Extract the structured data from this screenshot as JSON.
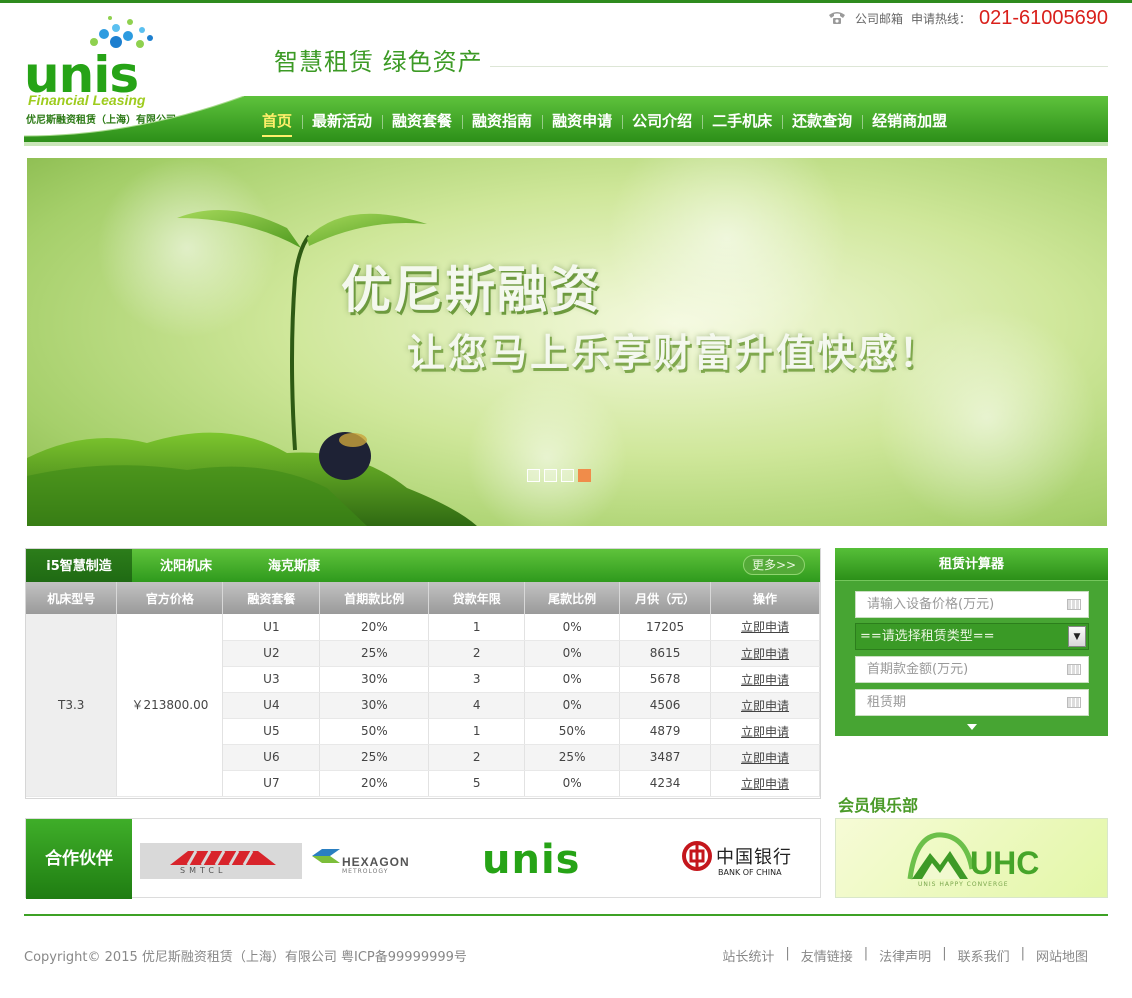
{
  "brand": {
    "logo_word": "unis",
    "logo_sub": "Financial  Leasing",
    "logo_cn": "优尼斯融资租赁（上海）有限公司",
    "slogan": "智慧租赁 绿色资产",
    "accent": "#3da125"
  },
  "topbar": {
    "mail": "公司邮箱",
    "hotline_label": "申请热线：",
    "hotline": "021-61005690"
  },
  "nav": {
    "items": [
      "首页",
      "最新活动",
      "融资套餐",
      "融资指南",
      "融资申请",
      "公司介绍",
      "二手机床",
      "还款查询",
      "经销商加盟"
    ],
    "active": "首页"
  },
  "banner": {
    "title": "优尼斯融资",
    "subtitle": "让您马上乐享财富升值快感！",
    "slides": 4,
    "active_slide": 4
  },
  "products": {
    "tabs": [
      "i5智慧制造",
      "沈阳机床",
      "海克斯康"
    ],
    "more": "更多>>",
    "columns": [
      "机床型号",
      "官方价格",
      "融资套餐",
      "首期款比例",
      "贷款年限",
      "尾款比例",
      "月供（元）",
      "操作"
    ],
    "model": "T3.3",
    "price": "￥213800.00",
    "rows": [
      {
        "plan": "U1",
        "down": "20%",
        "years": "1",
        "final": "0%",
        "monthly": "17205",
        "action": "立即申请"
      },
      {
        "plan": "U2",
        "down": "25%",
        "years": "2",
        "final": "0%",
        "monthly": "8615",
        "action": "立即申请"
      },
      {
        "plan": "U3",
        "down": "30%",
        "years": "3",
        "final": "0%",
        "monthly": "5678",
        "action": "立即申请"
      },
      {
        "plan": "U4",
        "down": "30%",
        "years": "4",
        "final": "0%",
        "monthly": "4506",
        "action": "立即申请"
      },
      {
        "plan": "U5",
        "down": "50%",
        "years": "1",
        "final": "50%",
        "monthly": "4879",
        "action": "立即申请"
      },
      {
        "plan": "U6",
        "down": "25%",
        "years": "2",
        "final": "25%",
        "monthly": "3487",
        "action": "立即申请"
      },
      {
        "plan": "U7",
        "down": "20%",
        "years": "5",
        "final": "0%",
        "monthly": "4234",
        "action": "立即申请"
      }
    ]
  },
  "calculator": {
    "title": "租赁计算器",
    "price_placeholder": "请输入设备价格(万元)",
    "type_select": "==请选择租赁类型==",
    "down_placeholder": "首期款金额(万元)",
    "term_placeholder": "租赁期"
  },
  "club": {
    "title": "会员俱乐部",
    "logo": "UHC",
    "logo_sub": "UNIS HAPPY CONVERGE"
  },
  "partners": {
    "label": "合作伙伴",
    "logos": [
      {
        "name": "SMTCL"
      },
      {
        "name": "HEXAGON",
        "sub": "METROLOGY"
      },
      {
        "name": "unis"
      },
      {
        "name": "中国银行",
        "sub": "BANK OF CHINA"
      }
    ]
  },
  "footer": {
    "copyright": "Copyright© 2015 优尼斯融资租赁（上海）有限公司 粤ICP备99999999号",
    "links": [
      "站长统计",
      "友情链接",
      "法律声明",
      "联系我们",
      "网站地图"
    ]
  }
}
